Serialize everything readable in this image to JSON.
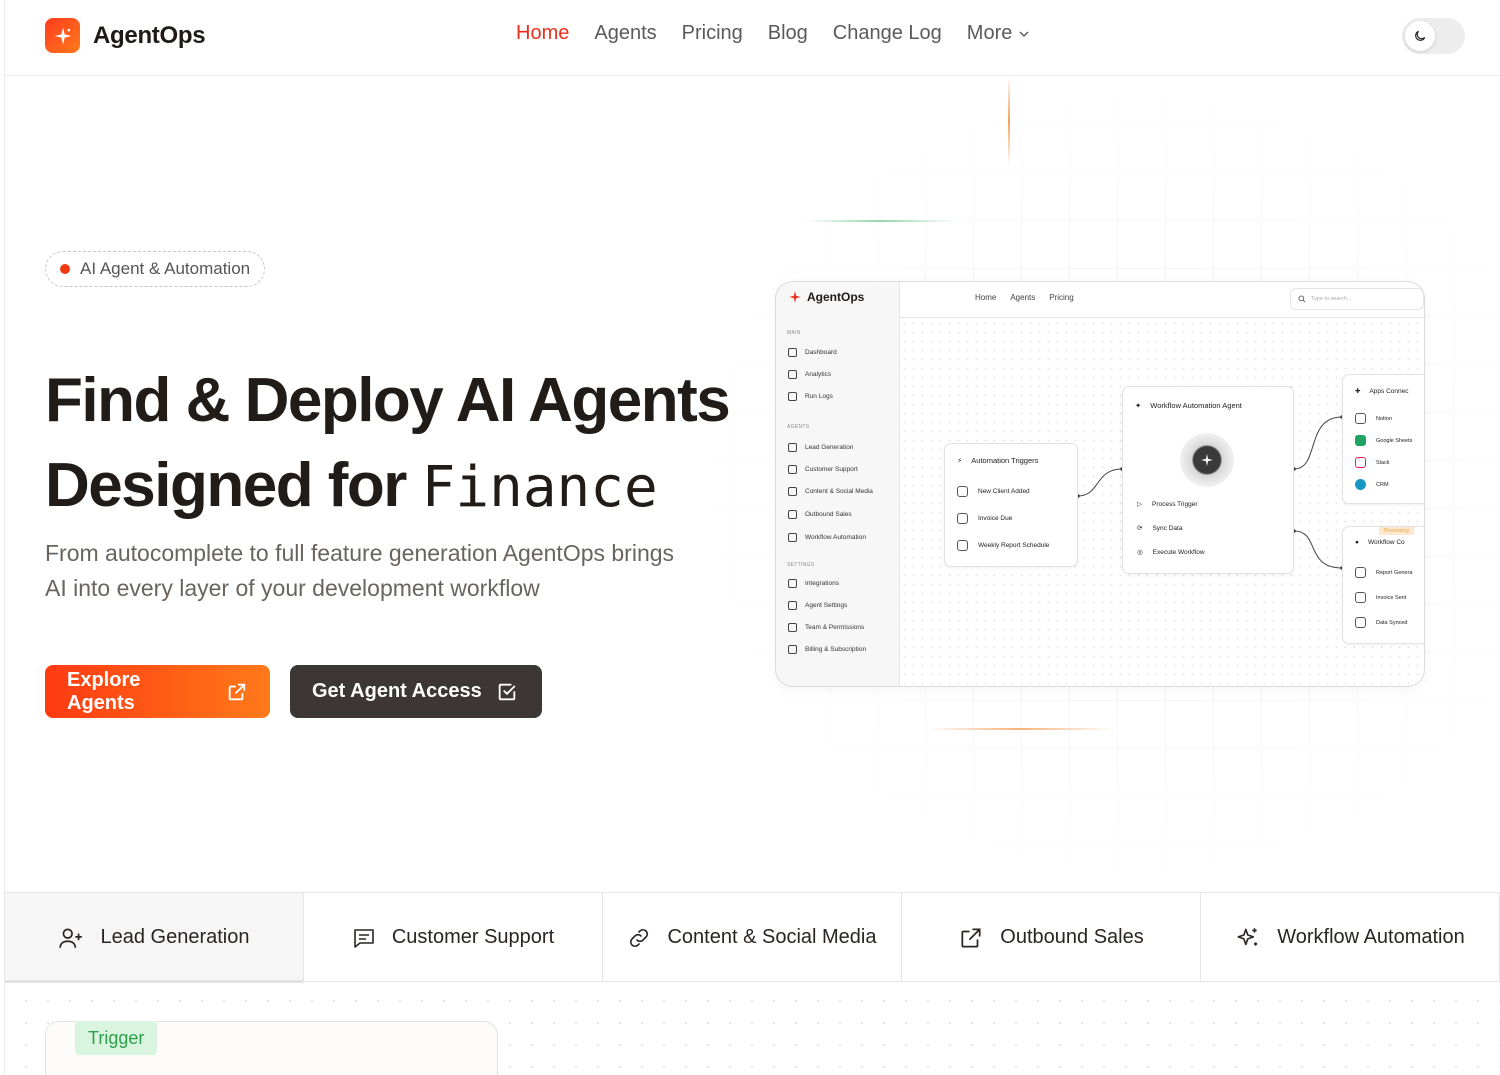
{
  "brand": {
    "name": "AgentOps",
    "accent": "#ef2e1a"
  },
  "nav": {
    "links": [
      "Home",
      "Agents",
      "Pricing",
      "Blog",
      "Change Log",
      "More"
    ],
    "active": "Home"
  },
  "hero": {
    "badge": "AI Agent & Automation",
    "headline_line1": "Find & Deploy AI Agents",
    "headline_line2_prefix": "Designed for",
    "headline_line2_word": "Finance",
    "subtitle": "From autocomplete to full feature generation AgentOps brings AI into every layer of your development workflow",
    "primary_button": "Explore Agents",
    "secondary_button": "Get Agent Access"
  },
  "mockup": {
    "brand": "AgentOps",
    "nav": [
      "Home",
      "Agents",
      "Pricing"
    ],
    "search_placeholder": "Type to search...",
    "sections": {
      "main": {
        "title": "MAIN",
        "items": [
          "Dashboard",
          "Analytics",
          "Run Logs"
        ]
      },
      "agents": {
        "title": "AGENTS",
        "items": [
          "Lead Generation",
          "Customer Support",
          "Content & Social Media",
          "Outbound Sales",
          "Workflow Automation"
        ]
      },
      "settings": {
        "title": "SETTINGS",
        "items": [
          "Integrations",
          "Agent Settings",
          "Team & Permissions",
          "Billing & Subscription"
        ]
      }
    },
    "triggers_card": {
      "title": "Automation Triggers",
      "rows": [
        "New Client Added",
        "Invoice Due",
        "Weekly Report Schedule"
      ]
    },
    "agent_card": {
      "title": "Workflow Automation Agent",
      "rows": [
        "Process Trigger",
        "Sync Data",
        "Execute Workflow"
      ]
    },
    "apps_card": {
      "title": "Apps Connec",
      "rows": [
        "Notion",
        "Google Sheets",
        "Slack",
        "CRM"
      ]
    },
    "workflow_card": {
      "badge": "Processing",
      "title": "Workflow Co",
      "rows": [
        "Report Genera",
        "Invoice Sent",
        "Data Synced"
      ]
    }
  },
  "tabs": [
    "Lead Generation",
    "Customer Support",
    "Content & Social Media",
    "Outbound Sales",
    "Workflow Automation"
  ],
  "below": {
    "tag": "Trigger"
  }
}
